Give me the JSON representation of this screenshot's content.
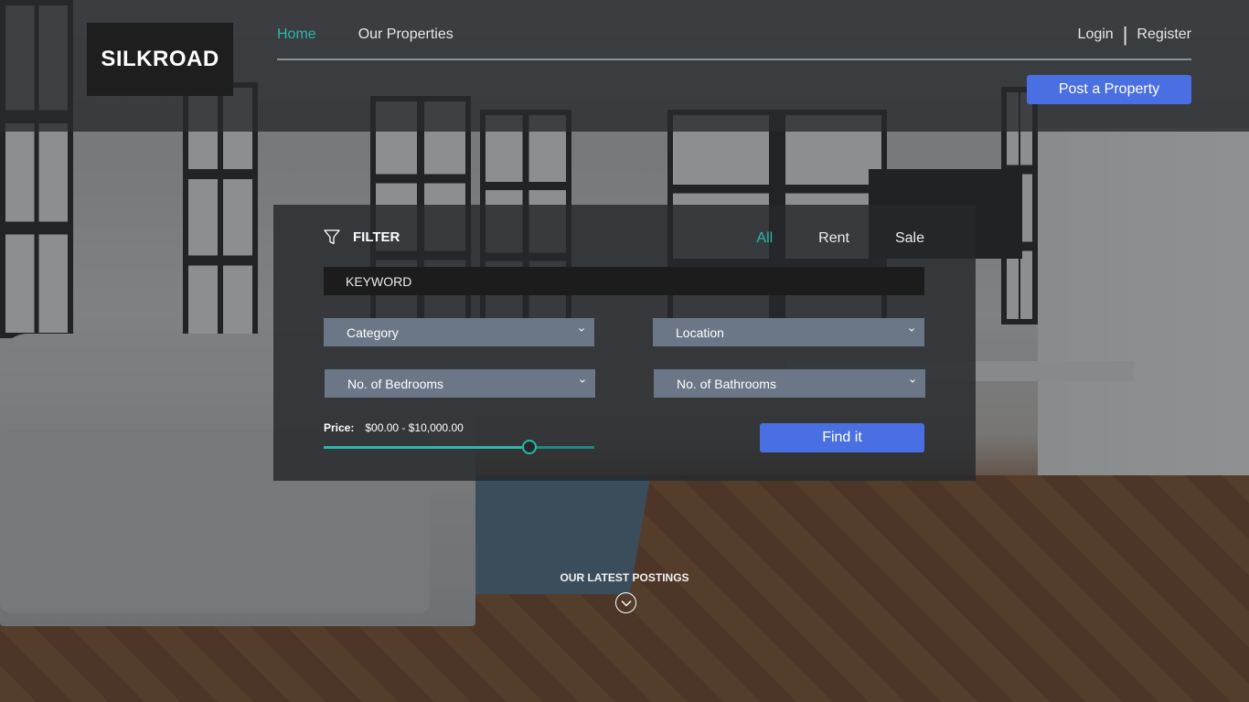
{
  "brand": {
    "logo_text": "SILKROAD"
  },
  "nav": {
    "items": [
      {
        "label": "Home",
        "active": true
      },
      {
        "label": "Our Properties",
        "active": false
      }
    ]
  },
  "auth": {
    "login": "Login",
    "separator": "|",
    "register": "Register"
  },
  "header": {
    "post_button": "Post a Property"
  },
  "filter": {
    "title": "FILTER",
    "icon": "filter-funnel-icon",
    "segments": [
      {
        "label": "All",
        "active": true
      },
      {
        "label": "Rent",
        "active": false
      },
      {
        "label": "Sale",
        "active": false
      }
    ],
    "keyword_placeholder": "KEYWORD",
    "selects": {
      "category": "Category",
      "location": "Location",
      "bedrooms": "No. of Bedrooms",
      "bathrooms": "No. of Bathrooms"
    },
    "price": {
      "label": "Price:",
      "range_text": "$00.00 - $10,000.00",
      "slider_fraction": 0.76
    },
    "find_button": "Find it"
  },
  "latest": {
    "heading": "OUR LATEST POSTINGS",
    "icon": "chevron-down-circle-icon"
  },
  "colors": {
    "accent_teal": "#2bb8a8",
    "primary_blue": "#4a6fe3",
    "select_bg": "#6b7786",
    "panel_bg": "#26282b"
  }
}
